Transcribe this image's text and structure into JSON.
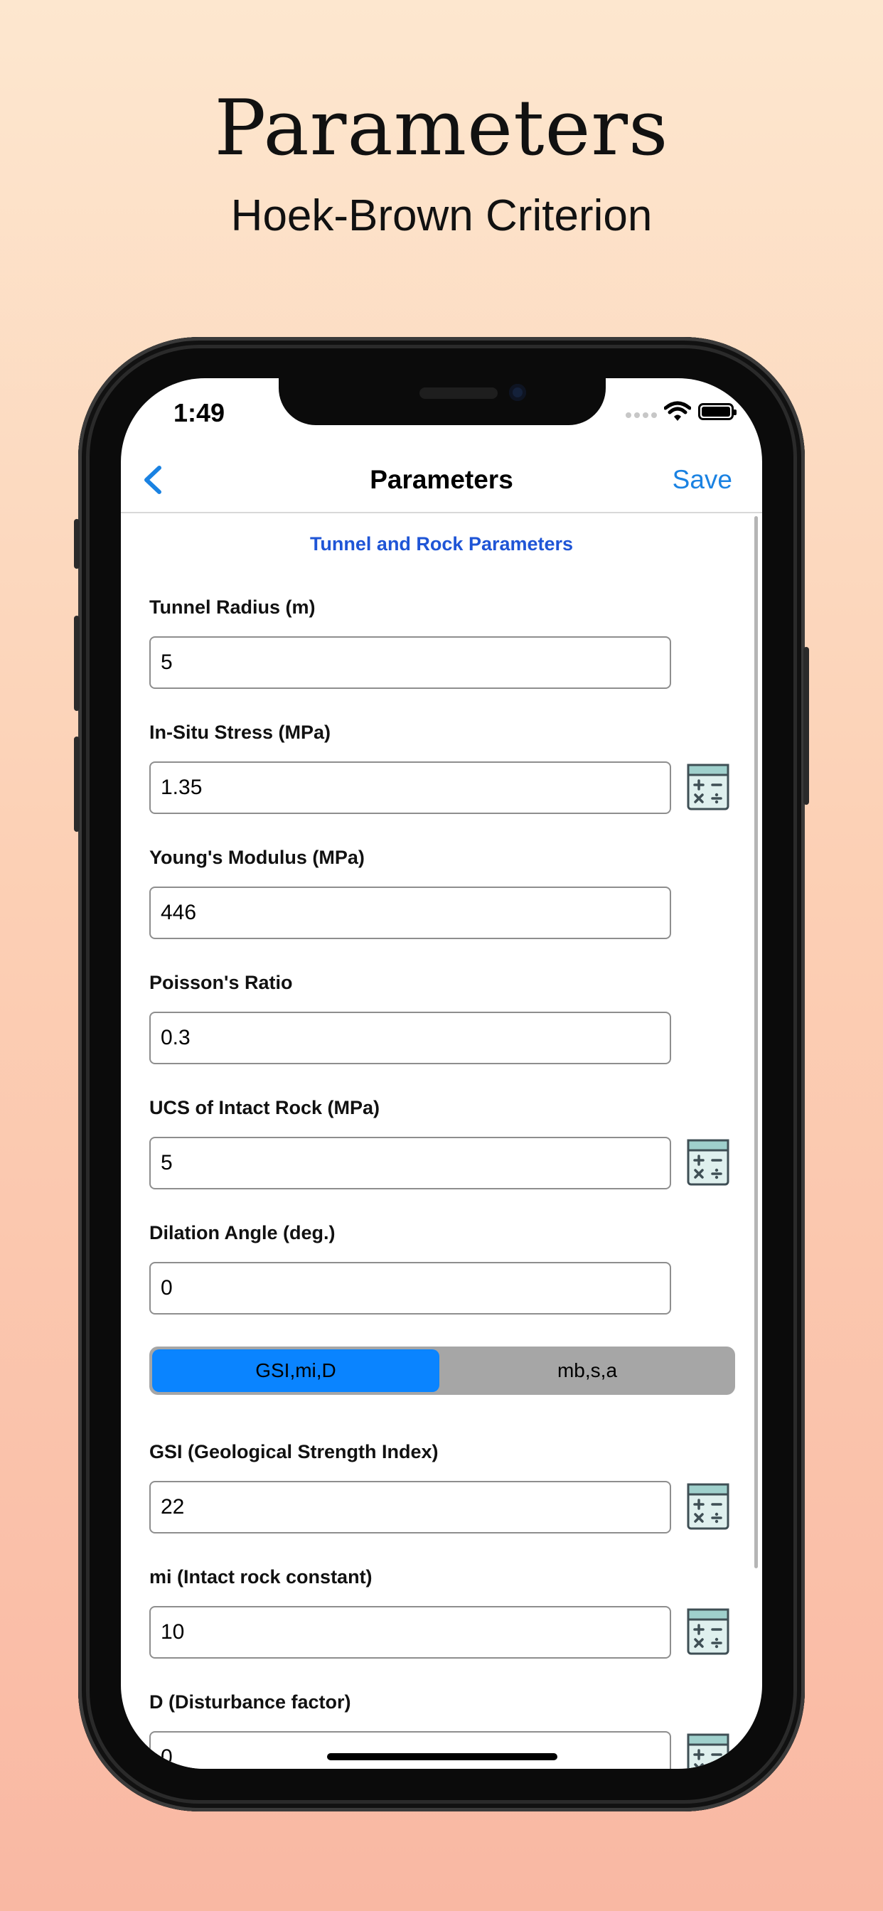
{
  "promo": {
    "title": "Parameters",
    "subtitle": "Hoek-Brown Criterion"
  },
  "status": {
    "time": "1:49",
    "icons": [
      "cellular-dots-icon",
      "wifi-icon",
      "battery-icon"
    ]
  },
  "nav": {
    "back_icon": "chevron-left-icon",
    "title": "Parameters",
    "save_label": "Save"
  },
  "section_title": "Tunnel and Rock Parameters",
  "fields": [
    {
      "label": "Tunnel Radius (m)",
      "value": "5"
    },
    {
      "label": "In-Situ Stress (MPa)",
      "value": "1.35"
    },
    {
      "label": "Young's Modulus (MPa)",
      "value": "446"
    },
    {
      "label": "Poisson's Ratio",
      "value": "0.3"
    },
    {
      "label": "UCS of Intact Rock (MPa)",
      "value": "5"
    },
    {
      "label": "Dilation Angle (deg.)",
      "value": "0"
    }
  ],
  "segmented": {
    "options": [
      "GSI,mi,D",
      "mb,s,a"
    ],
    "selected": "GSI,mi,D"
  },
  "hb_fields": [
    {
      "label": "GSI (Geological Strength Index)",
      "value": "22"
    },
    {
      "label": "mi (Intact rock constant)",
      "value": "10"
    },
    {
      "label": "D (Disturbance factor)",
      "value": "0"
    }
  ],
  "colors": {
    "accent": "#1a82e2",
    "section_title": "#1f55d6",
    "segment_active": "#0a84ff",
    "segment_bg": "#a6a6a6"
  }
}
